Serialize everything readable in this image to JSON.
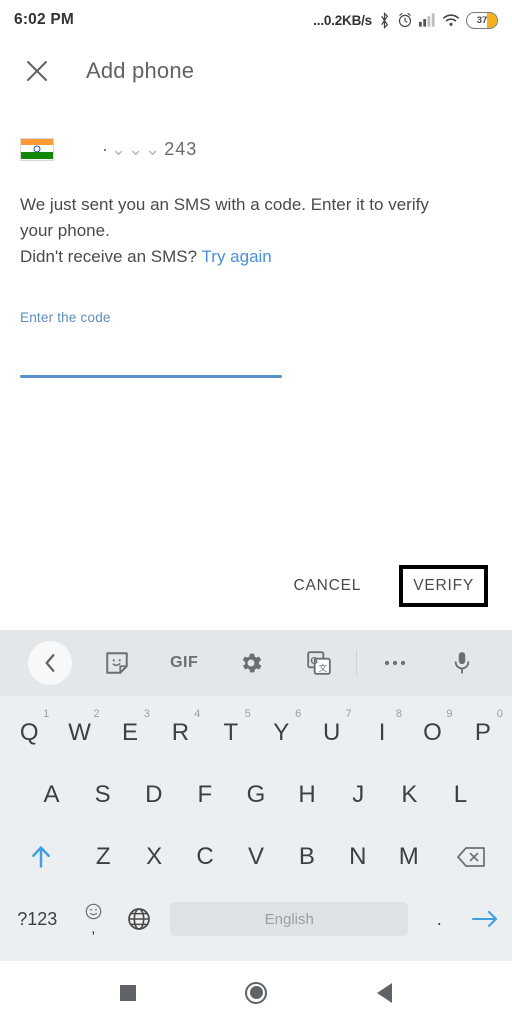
{
  "status_bar": {
    "time": "6:02 PM",
    "network_speed": "...0.2KB/s",
    "battery_level": "37",
    "icons": [
      "bluetooth-icon",
      "alarm-icon",
      "signal-icon",
      "wifi-icon",
      "battery-icon"
    ]
  },
  "app_bar": {
    "close_label": "✕",
    "title": "Add phone"
  },
  "phone": {
    "country_flag": "india-flag",
    "mask": "⌄⌄⌄",
    "dot": "·",
    "number": "243"
  },
  "message": {
    "line1": "We just sent you an SMS with a code. Enter it to verify",
    "line2": "your phone.",
    "line3": "Didn't receive an SMS?",
    "retry_link": "Try again"
  },
  "code_field": {
    "label": "Enter the code",
    "value": "",
    "placeholder": ""
  },
  "actions": {
    "cancel_label": "CANCEL",
    "verify_label": "VERIFY"
  },
  "keyboard": {
    "toolbar": [
      {
        "name": "back-chevron-icon",
        "glyph": "‹"
      },
      {
        "name": "sticker-icon",
        "glyph": ""
      },
      {
        "name": "gif-icon",
        "glyph": "GIF"
      },
      {
        "name": "settings-gear-icon",
        "glyph": ""
      },
      {
        "name": "google-translate-icon",
        "glyph": ""
      },
      {
        "name": "toolbar-divider",
        "glyph": ""
      },
      {
        "name": "more-options-icon",
        "glyph": "•••"
      },
      {
        "name": "microphone-icon",
        "glyph": ""
      }
    ],
    "row1": [
      {
        "letter": "Q",
        "sup": "1"
      },
      {
        "letter": "W",
        "sup": "2"
      },
      {
        "letter": "E",
        "sup": "3"
      },
      {
        "letter": "R",
        "sup": "4"
      },
      {
        "letter": "T",
        "sup": "5"
      },
      {
        "letter": "Y",
        "sup": "6"
      },
      {
        "letter": "U",
        "sup": "7"
      },
      {
        "letter": "I",
        "sup": "8"
      },
      {
        "letter": "O",
        "sup": "9"
      },
      {
        "letter": "P",
        "sup": "0"
      }
    ],
    "row2": [
      "A",
      "S",
      "D",
      "F",
      "G",
      "H",
      "J",
      "K",
      "L"
    ],
    "row3": [
      "Z",
      "X",
      "C",
      "V",
      "B",
      "N",
      "M"
    ],
    "shift_icon": "shift-arrow-icon",
    "backspace_icon": "backspace-icon",
    "symbols_label": "?123",
    "emoji_icon": "emoji-icon",
    "comma_label": ",",
    "globe_icon": "language-globe-icon",
    "space_label": "English",
    "period_label": ".",
    "enter_icon": "enter-arrow-icon"
  },
  "nav_bar": {
    "recents_label": "recents-square-icon",
    "home_label": "home-circle-icon",
    "back_label": "back-triangle-icon"
  },
  "colors": {
    "accent_blue": "#4a90d9",
    "field_blue": "#5b8fc9",
    "key_blue": "#3f9fe0",
    "battery_orange": "#f3b21b",
    "text_gray": "#4a4a4a"
  }
}
